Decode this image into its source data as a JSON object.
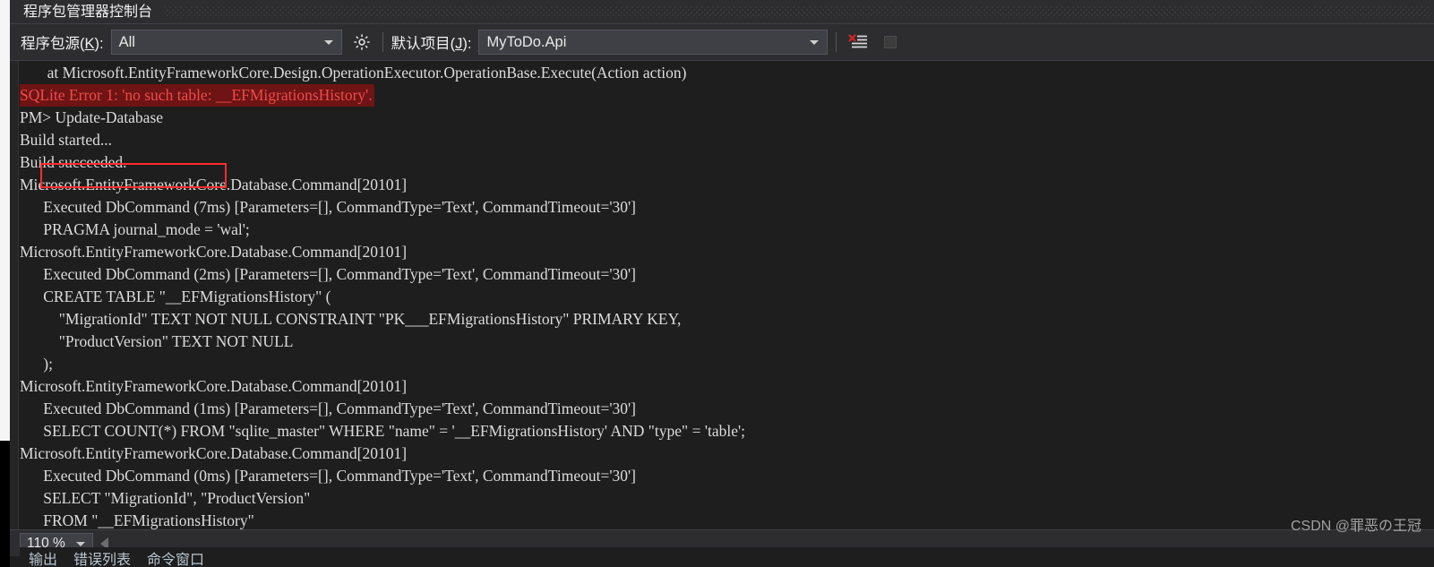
{
  "window": {
    "title": "程序包管理器控制台"
  },
  "toolbar": {
    "source_label_pre": "程序包源(",
    "source_label_key": "K",
    "source_label_post": "): ",
    "source_value": "All",
    "settings_icon": "gear-icon",
    "project_label_pre": "默认项目(",
    "project_label_key": "J",
    "project_label_post": "): ",
    "project_value": "MyToDo.Api",
    "clear_icon": "clear-console-icon",
    "stop_icon": "stop-square-icon"
  },
  "console": {
    "lines": [
      {
        "text": "       at Microsoft.EntityFrameworkCore.Design.OperationExecutor.OperationBase.Execute(Action action)",
        "style": "normal"
      },
      {
        "text": "SQLite Error 1: 'no such table: __EFMigrationsHistory'.",
        "style": "error"
      },
      {
        "text": "PM> Update-Database",
        "style": "normal"
      },
      {
        "text": "Build started...",
        "style": "normal"
      },
      {
        "text": "Build succeeded.",
        "style": "normal"
      },
      {
        "text": "Microsoft.EntityFrameworkCore.Database.Command[20101]",
        "style": "normal"
      },
      {
        "text": "      Executed DbCommand (7ms) [Parameters=[], CommandType='Text', CommandTimeout='30']",
        "style": "normal"
      },
      {
        "text": "      PRAGMA journal_mode = 'wal';",
        "style": "normal"
      },
      {
        "text": "Microsoft.EntityFrameworkCore.Database.Command[20101]",
        "style": "normal"
      },
      {
        "text": "      Executed DbCommand (2ms) [Parameters=[], CommandType='Text', CommandTimeout='30']",
        "style": "normal"
      },
      {
        "text": "      CREATE TABLE \"__EFMigrationsHistory\" (",
        "style": "normal"
      },
      {
        "text": "          \"MigrationId\" TEXT NOT NULL CONSTRAINT \"PK___EFMigrationsHistory\" PRIMARY KEY,",
        "style": "normal"
      },
      {
        "text": "          \"ProductVersion\" TEXT NOT NULL",
        "style": "normal"
      },
      {
        "text": "      );",
        "style": "normal"
      },
      {
        "text": "Microsoft.EntityFrameworkCore.Database.Command[20101]",
        "style": "normal"
      },
      {
        "text": "      Executed DbCommand (1ms) [Parameters=[], CommandType='Text', CommandTimeout='30']",
        "style": "normal"
      },
      {
        "text": "      SELECT COUNT(*) FROM \"sqlite_master\" WHERE \"name\" = '__EFMigrationsHistory' AND \"type\" = 'table';",
        "style": "normal"
      },
      {
        "text": "Microsoft.EntityFrameworkCore.Database.Command[20101]",
        "style": "normal"
      },
      {
        "text": "      Executed DbCommand (0ms) [Parameters=[], CommandType='Text', CommandTimeout='30']",
        "style": "normal"
      },
      {
        "text": "      SELECT \"MigrationId\", \"ProductVersion\"",
        "style": "normal"
      },
      {
        "text": "      FROM \"__EFMigrationsHistory\"",
        "style": "normal"
      }
    ],
    "annotation": {
      "target_text": "PM> Update-Database",
      "color": "#ff2d2d"
    }
  },
  "statusbar": {
    "zoom_value": "110 %",
    "scroll_left_icon": "scroll-left-arrow-icon"
  },
  "tabs": [
    {
      "label": "输出"
    },
    {
      "label": "错误列表"
    },
    {
      "label": "命令窗口"
    }
  ],
  "watermark": {
    "text": "CSDN @罪恶の王冠"
  },
  "colors": {
    "error_text": "#f04a4a",
    "error_bg": "#6e1414",
    "annotation": "#ff2d2d",
    "console_bg": "#1e1e1e",
    "chrome_bg": "#2d2d30"
  }
}
